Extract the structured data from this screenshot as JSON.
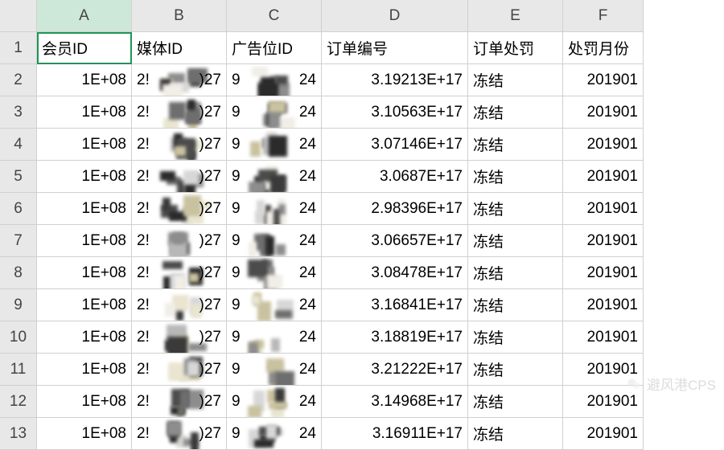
{
  "columns": [
    "A",
    "B",
    "C",
    "D",
    "E",
    "F"
  ],
  "headers": {
    "A": "会员ID",
    "B": "媒体ID",
    "C": "广告位ID",
    "D": "订单编号",
    "E": "订单处罚",
    "F": "处罚月份"
  },
  "rows": [
    2,
    3,
    4,
    5,
    6,
    7,
    8,
    9,
    10,
    11,
    12,
    13
  ],
  "data": {
    "A": [
      "1E+08",
      "1E+08",
      "1E+08",
      "1E+08",
      "1E+08",
      "1E+08",
      "1E+08",
      "1E+08",
      "1E+08",
      "1E+08",
      "1E+08",
      "1E+08"
    ],
    "B_prefix": [
      "2!",
      "2!",
      "2!",
      "2!",
      "2!",
      "2!",
      "2!",
      "2!",
      "2!",
      "2!",
      "2!",
      "2!"
    ],
    "B_suffix": [
      ")27",
      ")27",
      ")27",
      ")27",
      ")27",
      ")27",
      ")27",
      ")27",
      ")27",
      ")27",
      ")27",
      ")27"
    ],
    "C_prefix": [
      "9",
      "9",
      "9",
      "9",
      "9",
      "9",
      "9",
      "9",
      "9",
      "9",
      "9",
      "9"
    ],
    "C_suffix": [
      "24",
      "24",
      "24",
      "24",
      "24",
      "24",
      "24",
      "24",
      "24",
      "24",
      "24",
      "24"
    ],
    "D": [
      "3.19213E+17",
      "3.10563E+17",
      "3.07146E+17",
      "3.0687E+17",
      "2.98396E+17",
      "3.06657E+17",
      "3.08478E+17",
      "3.16841E+17",
      "3.18819E+17",
      "3.21222E+17",
      "3.14968E+17",
      "3.16911E+17"
    ],
    "E": [
      "冻结",
      "冻结",
      "冻结",
      "冻结",
      "冻结",
      "冻结",
      "冻结",
      "冻结",
      "冻结",
      "冻结",
      "冻结",
      "冻结"
    ],
    "F": [
      "201901",
      "201901",
      "201901",
      "201901",
      "201901",
      "201901",
      "201901",
      "201901",
      "201901",
      "201901",
      "201901",
      "201901"
    ]
  },
  "active_cell": "A1",
  "watermark": "避风港CPS",
  "chart_data": {
    "type": "table",
    "columns": [
      "会员ID",
      "媒体ID",
      "广告位ID",
      "订单编号",
      "订单处罚",
      "处罚月份"
    ],
    "note": "媒体ID 与 广告位ID 列中间部分被像素化遮挡，仅可见前后片段",
    "rows": [
      {
        "会员ID": "1E+08",
        "媒体ID": "2…)27",
        "广告位ID": "9…24",
        "订单编号": "3.19213E+17",
        "订单处罚": "冻结",
        "处罚月份": "201901"
      },
      {
        "会员ID": "1E+08",
        "媒体ID": "2…)27",
        "广告位ID": "9…24",
        "订单编号": "3.10563E+17",
        "订单处罚": "冻结",
        "处罚月份": "201901"
      },
      {
        "会员ID": "1E+08",
        "媒体ID": "2…)27",
        "广告位ID": "9…24",
        "订单编号": "3.07146E+17",
        "订单处罚": "冻结",
        "处罚月份": "201901"
      },
      {
        "会员ID": "1E+08",
        "媒体ID": "2…)27",
        "广告位ID": "9…24",
        "订单编号": "3.0687E+17",
        "订单处罚": "冻结",
        "处罚月份": "201901"
      },
      {
        "会员ID": "1E+08",
        "媒体ID": "2…)27",
        "广告位ID": "9…24",
        "订单编号": "2.98396E+17",
        "订单处罚": "冻结",
        "处罚月份": "201901"
      },
      {
        "会员ID": "1E+08",
        "媒体ID": "2…)27",
        "广告位ID": "9…24",
        "订单编号": "3.06657E+17",
        "订单处罚": "冻结",
        "处罚月份": "201901"
      },
      {
        "会员ID": "1E+08",
        "媒体ID": "2…)27",
        "广告位ID": "9…24",
        "订单编号": "3.08478E+17",
        "订单处罚": "冻结",
        "处罚月份": "201901"
      },
      {
        "会员ID": "1E+08",
        "媒体ID": "2…)27",
        "广告位ID": "9…24",
        "订单编号": "3.16841E+17",
        "订单处罚": "冻结",
        "处罚月份": "201901"
      },
      {
        "会员ID": "1E+08",
        "媒体ID": "2…)27",
        "广告位ID": "9…24",
        "订单编号": "3.18819E+17",
        "订单处罚": "冻结",
        "处罚月份": "201901"
      },
      {
        "会员ID": "1E+08",
        "媒体ID": "2…)27",
        "广告位ID": "9…24",
        "订单编号": "3.21222E+17",
        "订单处罚": "冻结",
        "处罚月份": "201901"
      },
      {
        "会员ID": "1E+08",
        "媒体ID": "2…)27",
        "广告位ID": "9…24",
        "订单编号": "3.14968E+17",
        "订单处罚": "冻结",
        "处罚月份": "201901"
      },
      {
        "会员ID": "1E+08",
        "媒体ID": "2…)27",
        "广告位ID": "9…24",
        "订单编号": "3.16911E+17",
        "订单处罚": "冻结",
        "处罚月份": "201901"
      }
    ]
  }
}
